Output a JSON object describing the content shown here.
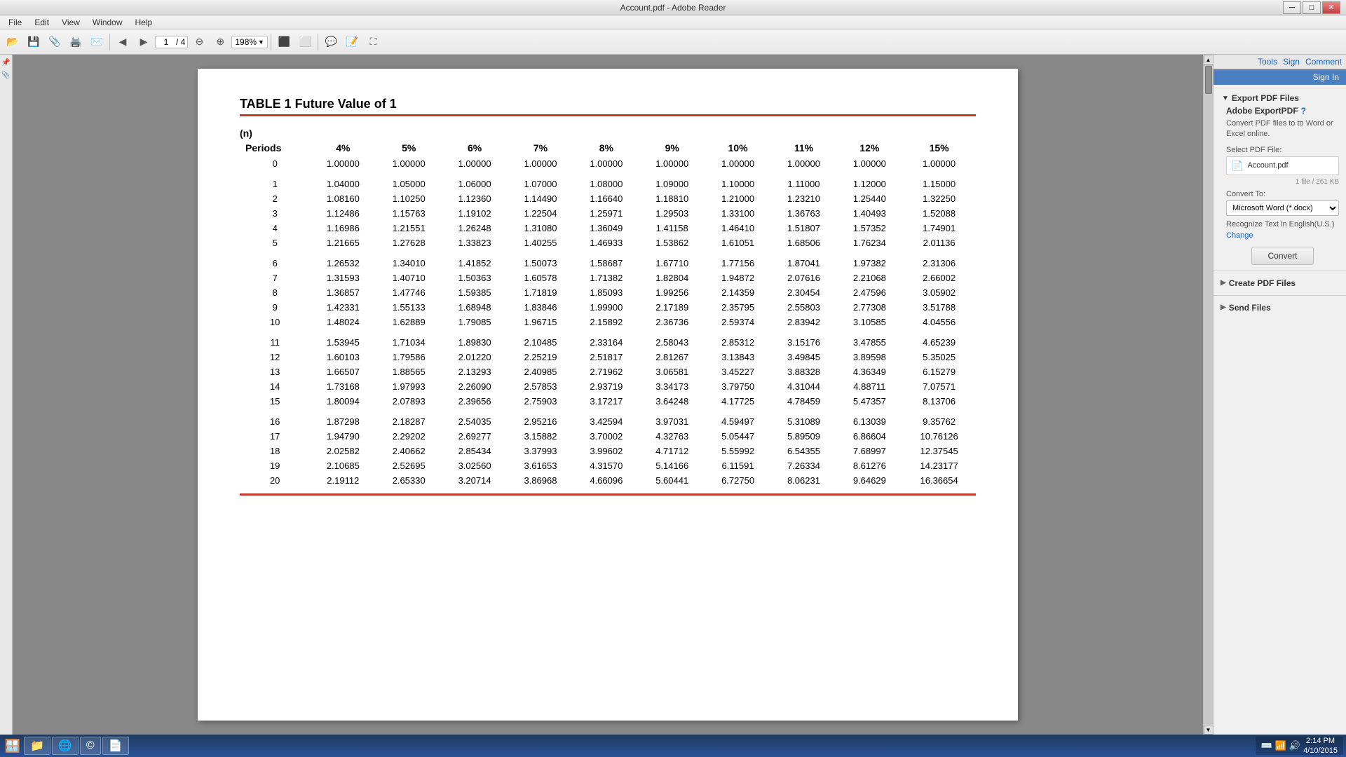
{
  "titleBar": {
    "title": "Account.pdf - Adobe Reader",
    "minBtn": "─",
    "maxBtn": "□",
    "closeBtn": "✕"
  },
  "menuBar": {
    "items": [
      "File",
      "Edit",
      "View",
      "Window",
      "Help"
    ]
  },
  "toolbar": {
    "pageInfo": "1",
    "pageTotal": "4",
    "zoom": "198%"
  },
  "pdf": {
    "tableTitle": "TABLE 1   Future Value of 1",
    "nLabel": "(n)",
    "periodsLabel": "Periods",
    "columns": [
      "4%",
      "5%",
      "6%",
      "7%",
      "8%",
      "9%",
      "10%",
      "11%",
      "12%",
      "15%"
    ],
    "rows": [
      [
        0,
        "1.00000",
        "1.00000",
        "1.00000",
        "1.00000",
        "1.00000",
        "1.00000",
        "1.00000",
        "1.00000",
        "1.00000",
        "1.00000"
      ],
      [
        1,
        "1.04000",
        "1.05000",
        "1.06000",
        "1.07000",
        "1.08000",
        "1.09000",
        "1.10000",
        "1.11000",
        "1.12000",
        "1.15000"
      ],
      [
        2,
        "1.08160",
        "1.10250",
        "1.12360",
        "1.14490",
        "1.16640",
        "1.18810",
        "1.21000",
        "1.23210",
        "1.25440",
        "1.32250"
      ],
      [
        3,
        "1.12486",
        "1.15763",
        "1.19102",
        "1.22504",
        "1.25971",
        "1.29503",
        "1.33100",
        "1.36763",
        "1.40493",
        "1.52088"
      ],
      [
        4,
        "1.16986",
        "1.21551",
        "1.26248",
        "1.31080",
        "1.36049",
        "1.41158",
        "1.46410",
        "1.51807",
        "1.57352",
        "1.74901"
      ],
      [
        5,
        "1.21665",
        "1.27628",
        "1.33823",
        "1.40255",
        "1.46933",
        "1.53862",
        "1.61051",
        "1.68506",
        "1.76234",
        "2.01136"
      ],
      [
        6,
        "1.26532",
        "1.34010",
        "1.41852",
        "1.50073",
        "1.58687",
        "1.67710",
        "1.77156",
        "1.87041",
        "1.97382",
        "2.31306"
      ],
      [
        7,
        "1.31593",
        "1.40710",
        "1.50363",
        "1.60578",
        "1.71382",
        "1.82804",
        "1.94872",
        "2.07616",
        "2.21068",
        "2.66002"
      ],
      [
        8,
        "1.36857",
        "1.47746",
        "1.59385",
        "1.71819",
        "1.85093",
        "1.99256",
        "2.14359",
        "2.30454",
        "2.47596",
        "3.05902"
      ],
      [
        9,
        "1.42331",
        "1.55133",
        "1.68948",
        "1.83846",
        "1.99900",
        "2.17189",
        "2.35795",
        "2.55803",
        "2.77308",
        "3.51788"
      ],
      [
        10,
        "1.48024",
        "1.62889",
        "1.79085",
        "1.96715",
        "2.15892",
        "2.36736",
        "2.59374",
        "2.83942",
        "3.10585",
        "4.04556"
      ],
      [
        11,
        "1.53945",
        "1.71034",
        "1.89830",
        "2.10485",
        "2.33164",
        "2.58043",
        "2.85312",
        "3.15176",
        "3.47855",
        "4.65239"
      ],
      [
        12,
        "1.60103",
        "1.79586",
        "2.01220",
        "2.25219",
        "2.51817",
        "2.81267",
        "3.13843",
        "3.49845",
        "3.89598",
        "5.35025"
      ],
      [
        13,
        "1.66507",
        "1.88565",
        "2.13293",
        "2.40985",
        "2.71962",
        "3.06581",
        "3.45227",
        "3.88328",
        "4.36349",
        "6.15279"
      ],
      [
        14,
        "1.73168",
        "1.97993",
        "2.26090",
        "2.57853",
        "2.93719",
        "3.34173",
        "3.79750",
        "4.31044",
        "4.88711",
        "7.07571"
      ],
      [
        15,
        "1.80094",
        "2.07893",
        "2.39656",
        "2.75903",
        "3.17217",
        "3.64248",
        "4.17725",
        "4.78459",
        "5.47357",
        "8.13706"
      ],
      [
        16,
        "1.87298",
        "2.18287",
        "2.54035",
        "2.95216",
        "3.42594",
        "3.97031",
        "4.59497",
        "5.31089",
        "6.13039",
        "9.35762"
      ],
      [
        17,
        "1.94790",
        "2.29202",
        "2.69277",
        "3.15882",
        "3.70002",
        "4.32763",
        "5.05447",
        "5.89509",
        "6.86604",
        "10.76126"
      ],
      [
        18,
        "2.02582",
        "2.40662",
        "2.85434",
        "3.37993",
        "3.99602",
        "4.71712",
        "5.55992",
        "6.54355",
        "7.68997",
        "12.37545"
      ],
      [
        19,
        "2.10685",
        "2.52695",
        "3.02560",
        "3.61653",
        "4.31570",
        "5.14166",
        "6.11591",
        "7.26334",
        "8.61276",
        "14.23177"
      ],
      [
        20,
        "2.19112",
        "2.65330",
        "3.20714",
        "3.86968",
        "4.66096",
        "5.60441",
        "6.72750",
        "8.06231",
        "9.64629",
        "16.36654"
      ]
    ]
  },
  "rightPanel": {
    "signInLabel": "Sign In",
    "toolsLabel": "Tools",
    "signLabel": "Sign",
    "commentLabel": "Comment",
    "exportSection": {
      "title": "Export PDF Files",
      "serviceTitle": "Adobe ExportPDF",
      "serviceDesc": "Convert PDF files to to Word or Excel online.",
      "helpIcon": "?",
      "selectFileLabel": "Select PDF File:",
      "fileName": "Account.pdf",
      "fileSize": "1 file / 261 KB",
      "convertToLabel": "Convert To:",
      "convertToOption": "Microsoft Word (*.docx)",
      "recognizeText": "Recognize Text in English(U.S.)",
      "changeLabel": "Change",
      "convertBtn": "Convert"
    },
    "createSection": "Create PDF Files",
    "sendSection": "Send Files"
  },
  "taskbar": {
    "time": "2:14 PM",
    "date": "4/10/2015",
    "apps": [
      {
        "icon": "🪟",
        "label": ""
      },
      {
        "icon": "📁",
        "label": ""
      },
      {
        "icon": "🌐",
        "label": ""
      },
      {
        "icon": "©",
        "label": ""
      },
      {
        "icon": "📄",
        "label": ""
      }
    ]
  }
}
